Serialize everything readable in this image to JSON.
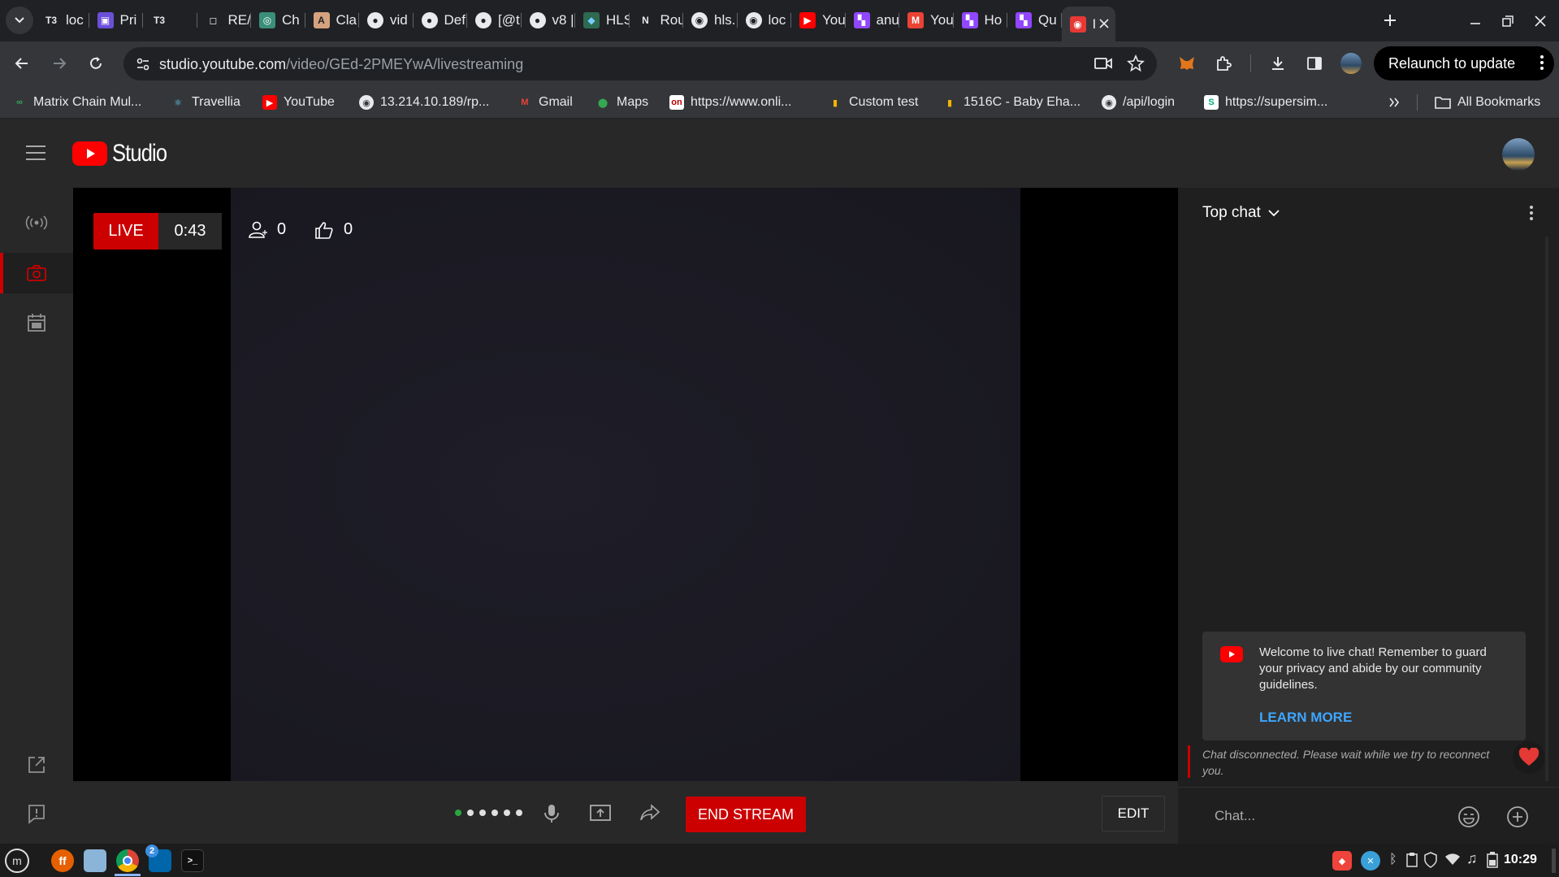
{
  "browser": {
    "tabs": [
      {
        "label": "loc",
        "fav": "T3"
      },
      {
        "label": "Pri",
        "fav": "P"
      },
      {
        "label": "",
        "fav": "T3"
      },
      {
        "label": "RE/",
        "fav": "R"
      },
      {
        "label": "Ch",
        "fav": "C"
      },
      {
        "label": "Cla",
        "fav": "A"
      },
      {
        "label": "vid",
        "fav": "gh"
      },
      {
        "label": "Def",
        "fav": "gh"
      },
      {
        "label": "[@t",
        "fav": "gh"
      },
      {
        "label": "v8 |",
        "fav": "gh"
      },
      {
        "label": "HLS",
        "fav": "H"
      },
      {
        "label": "Rou",
        "fav": "N"
      },
      {
        "label": "hls.",
        "fav": "g"
      },
      {
        "label": "loc",
        "fav": "g"
      },
      {
        "label": "You",
        "fav": "yt"
      },
      {
        "label": "anu",
        "fav": "tw"
      },
      {
        "label": "You",
        "fav": "M"
      },
      {
        "label": "Ho",
        "fav": "tw"
      },
      {
        "label": "Qu",
        "fav": "tw"
      },
      {
        "label": "I",
        "fav": "live"
      }
    ],
    "url_domain": "studio.youtube.com",
    "url_path": "/video/GEd-2PMEYwA/livestreaming",
    "relaunch_label": "Relaunch to update",
    "bookmarks": [
      {
        "label": "Matrix Chain Mul...",
        "fav": "mc"
      },
      {
        "label": "Travellia",
        "fav": "re"
      },
      {
        "label": "YouTube",
        "fav": "yt"
      },
      {
        "label": "13.214.10.189/rp...",
        "fav": "gl"
      },
      {
        "label": "Gmail",
        "fav": "M"
      },
      {
        "label": "Maps",
        "fav": "map"
      },
      {
        "label": "https://www.onli...",
        "fav": "on"
      },
      {
        "label": "Custom test",
        "fav": "bar"
      },
      {
        "label": "1516C - Baby Eha...",
        "fav": "bar"
      },
      {
        "label": "/api/login",
        "fav": "gl"
      },
      {
        "label": "https://supersim...",
        "fav": "S"
      }
    ],
    "all_bookmarks_label": "All Bookmarks"
  },
  "studio": {
    "logo_text": "Studio",
    "live_label": "LIVE",
    "timer": "0:43",
    "viewers": "0",
    "likes": "0",
    "end_stream_label": "END STREAM",
    "edit_label": "EDIT"
  },
  "chat": {
    "mode_label": "Top chat",
    "welcome_text": "Welcome to live chat! Remember to guard your privacy and abide by our community guidelines.",
    "learn_more_label": "LEARN MORE",
    "disconnected_text": "Chat disconnected. Please wait while we try to reconnect you.",
    "input_placeholder": "Chat..."
  },
  "taskbar": {
    "clock": "10:29",
    "vscode_badge": "2"
  },
  "colors": {
    "live_red": "#cc0000",
    "link_blue": "#3ea6ff",
    "studio_bg": "#282828"
  }
}
